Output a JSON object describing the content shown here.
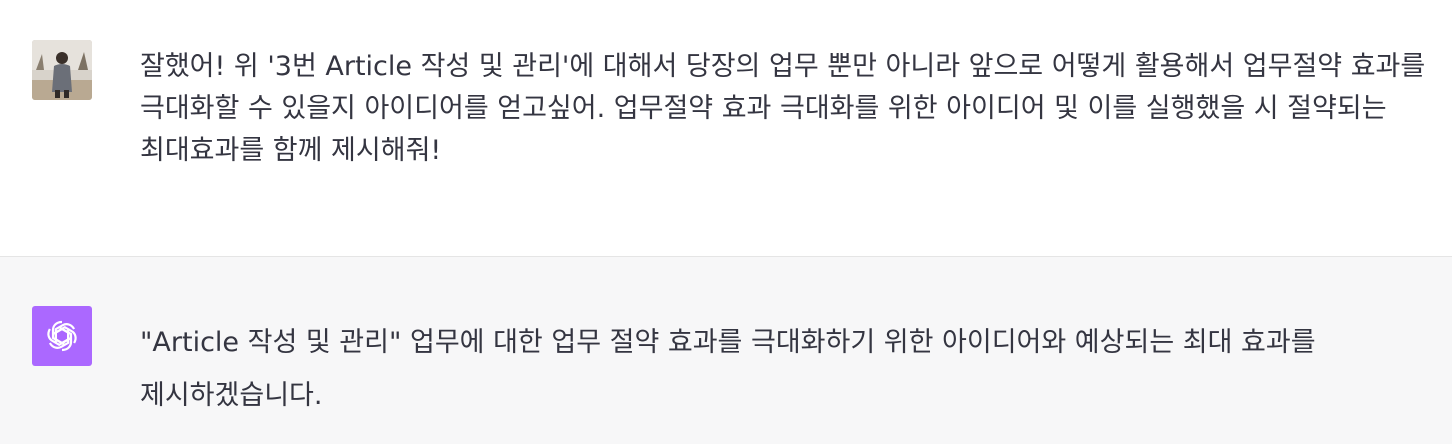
{
  "user_message": {
    "text": "잘했어! 위 '3번 Article 작성 및 관리'에 대해서 당장의 업무 뿐만 아니라 앞으로 어떻게 활용해서 업무절약 효과를 극대화할 수 있을지 아이디어를 얻고싶어. 업무절약 효과 극대화를 위한 아이디어 및 이를 실행했을 시 절약되는 최대효과를 함께 제시해줘!",
    "avatar_icon": "user-photo-avatar"
  },
  "assistant_message": {
    "text": "\"Article 작성 및 관리\" 업무에 대한 업무 절약 효과를 극대화하기 위한 아이디어와 예상되는 최대 효과를 제시하겠습니다.",
    "avatar_icon": "openai-logo-icon",
    "avatar_color": "#ab68ff"
  },
  "colors": {
    "user_bg": "#ffffff",
    "assistant_bg": "#f7f7f8",
    "divider": "#e5e5e5",
    "text": "#343541"
  }
}
